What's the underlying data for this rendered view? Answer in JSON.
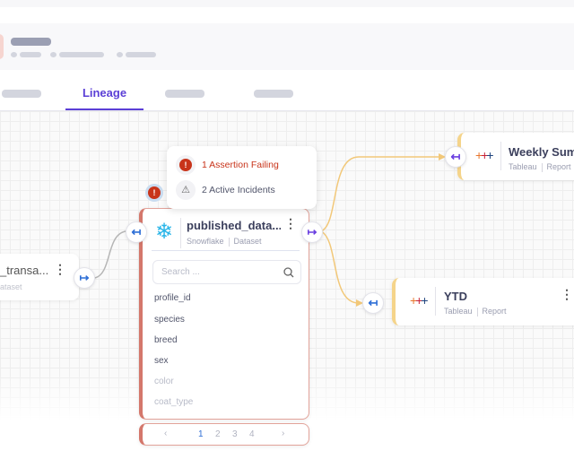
{
  "tabs": {
    "active": "Lineage"
  },
  "tooltip": {
    "assertion": "1 Assertion Failing",
    "incidents": "2 Active Incidents"
  },
  "colors": {
    "accent": "#5b3fd6",
    "error": "#c8341a",
    "upstream_edge": "#b5b5b5",
    "downstream_edge": "#f2c879",
    "node_error_border": "#d4776b",
    "report_border": "#f5d48a"
  },
  "left_node": {
    "title": "_transa...",
    "subtitle": "ataset"
  },
  "main_node": {
    "title": "published_data...",
    "platform": "Snowflake",
    "type": "Dataset",
    "search_placeholder": "Search ...",
    "fields": [
      "profile_id",
      "species",
      "breed",
      "sex",
      "color",
      "coat_type"
    ],
    "pagination": {
      "pages": [
        "1",
        "2",
        "3",
        "4"
      ],
      "current": "1"
    }
  },
  "weekly_node": {
    "title": "Weekly Summ",
    "platform": "Tableau",
    "type": "Report"
  },
  "ytd_node": {
    "title": "YTD",
    "platform": "Tableau",
    "type": "Report"
  }
}
